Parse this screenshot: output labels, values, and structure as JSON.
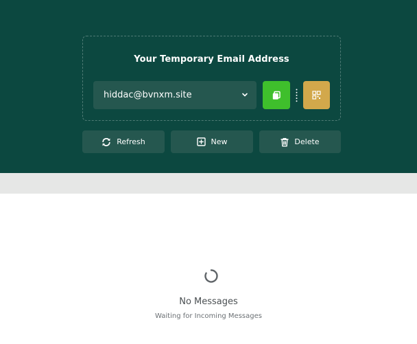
{
  "temp_mail": {
    "title": "Your Temporary Email Address",
    "email_address": "hiddac@bvnxm.site",
    "icons": {
      "dropdown": "chevron-down-icon",
      "copy": "copy-icon",
      "menu": "vertical-dots-icon",
      "qr": "qr-code-icon"
    }
  },
  "actions": {
    "refresh_label": "Refresh",
    "new_label": "New",
    "delete_label": "Delete",
    "icons": [
      "refresh-icon",
      "plus-square-icon",
      "trash-icon"
    ]
  },
  "inbox": {
    "empty_title": "No Messages",
    "empty_subtitle": "Waiting for Incoming Messages",
    "status_icon": "loading-spinner-icon"
  },
  "colors": {
    "hero_background": "#0c4840",
    "control_background": "#25574f",
    "copy_button": "#3fbf2c",
    "qr_button": "#d2a84b",
    "separator_band": "#e6e7e6"
  }
}
